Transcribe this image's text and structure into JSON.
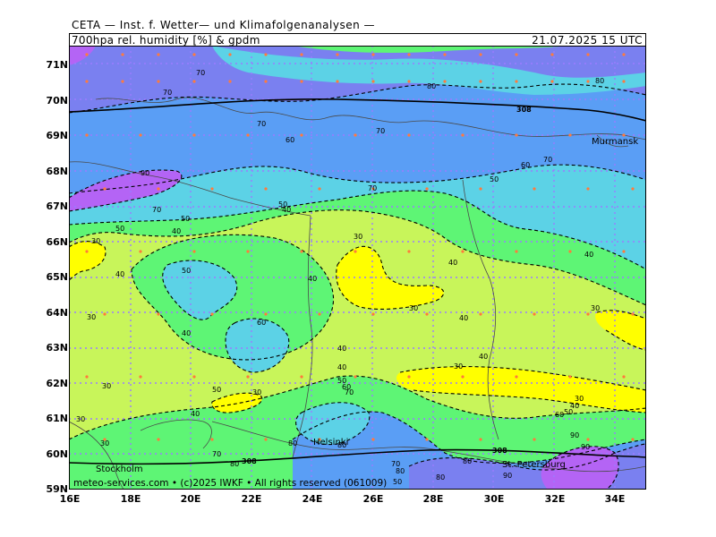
{
  "header": {
    "title": "CETA — Inst. f. Wetter— und Klimafolgenanalysen —",
    "parameter": "700hpa  rel. humidity  [%]  &  gpdm",
    "valid_time": "21.07.2025  15 UTC"
  },
  "axes": {
    "latitudes": [
      "71N",
      "70N",
      "69N",
      "68N",
      "67N",
      "66N",
      "65N",
      "64N",
      "63N",
      "62N",
      "61N",
      "60N",
      "59N"
    ],
    "longitudes": [
      "16E",
      "18E",
      "20E",
      "22E",
      "24E",
      "26E",
      "28E",
      "30E",
      "32E",
      "34E"
    ]
  },
  "places": [
    {
      "name": "Murmansk"
    },
    {
      "name": "Stockholm"
    },
    {
      "name": "Helsinki"
    },
    {
      "name": "St. Petersburg"
    }
  ],
  "contour_labels": [
    "30",
    "40",
    "50",
    "60",
    "70",
    "80",
    "90",
    "308"
  ],
  "legend_colors": {
    "h30": "#ffff00",
    "h40": "#c8f55a",
    "h50": "#5ef575",
    "h60": "#5cd2e6",
    "h70": "#5a9ef5",
    "h80": "#7a80f0",
    "h90": "#b464f5"
  },
  "footer": {
    "copyright": "meteo-services.com  •  (c)2025  IWKF  •  All rights reserved  (061009)"
  }
}
